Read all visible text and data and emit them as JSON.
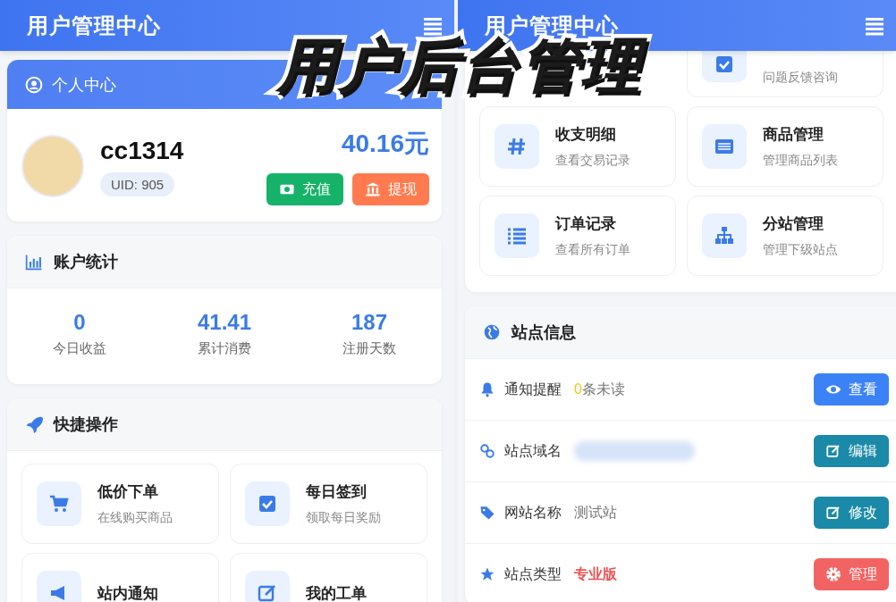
{
  "left_screen": {
    "app_bar": {
      "title": "用户管理中心"
    },
    "profile": {
      "section_title": "个人中心",
      "username": "cc1314",
      "uid": "UID: 905",
      "balance": "40.16元",
      "buttons": [
        {
          "label": "充值",
          "kind": "recharge"
        },
        {
          "label": "提现",
          "kind": "withdraw"
        }
      ]
    },
    "stats": {
      "title": "账户统计",
      "items": [
        {
          "value": "0",
          "label": "今日收益"
        },
        {
          "value": "41.41",
          "label": "累计消费"
        },
        {
          "value": "187",
          "label": "注册天数"
        }
      ]
    },
    "quick_actions": {
      "title": "快捷操作",
      "items": [
        {
          "kind": "cart",
          "title": "低价下单",
          "subtitle": "在线购买商品"
        },
        {
          "kind": "check",
          "title": "每日签到",
          "subtitle": "领取每日奖励"
        },
        {
          "kind": "megaphone",
          "title": "站内通知"
        },
        {
          "kind": "edit",
          "title": "我的工单"
        }
      ]
    }
  },
  "right_screen": {
    "app_bar": {
      "title": "用户管理中心"
    },
    "quick_actions": {
      "items": [
        {
          "kind": "blank"
        },
        {
          "kind": "check",
          "subtitle": "问题反馈咨询"
        },
        {
          "kind": "hash",
          "title": "收支明细",
          "subtitle": "查看交易记录"
        },
        {
          "kind": "card-list",
          "title": "商品管理",
          "subtitle": "管理商品列表"
        },
        {
          "kind": "list",
          "title": "订单记录",
          "subtitle": "查看所有订单"
        },
        {
          "kind": "sitemap",
          "title": "分站管理",
          "subtitle": "管理下级站点"
        }
      ]
    },
    "site_info": {
      "title": "站点信息",
      "rows": [
        {
          "kind": "bell",
          "label": "通知提醒",
          "count": "0",
          "value": "条未读",
          "button": {
            "label": "查看",
            "kind": "view"
          }
        },
        {
          "kind": "link",
          "label": "站点域名",
          "value_blurred": true,
          "button": {
            "label": "编辑",
            "kind": "edit"
          }
        },
        {
          "kind": "tag",
          "label": "网站名称",
          "value": "测试站",
          "button": {
            "label": "修改",
            "kind": "edit"
          }
        },
        {
          "kind": "star",
          "label": "站点类型",
          "value": "专业版",
          "highlighted": true,
          "button": {
            "label": "管理",
            "kind": "manage"
          }
        }
      ]
    }
  },
  "overlay_caption": "用户后台管理"
}
